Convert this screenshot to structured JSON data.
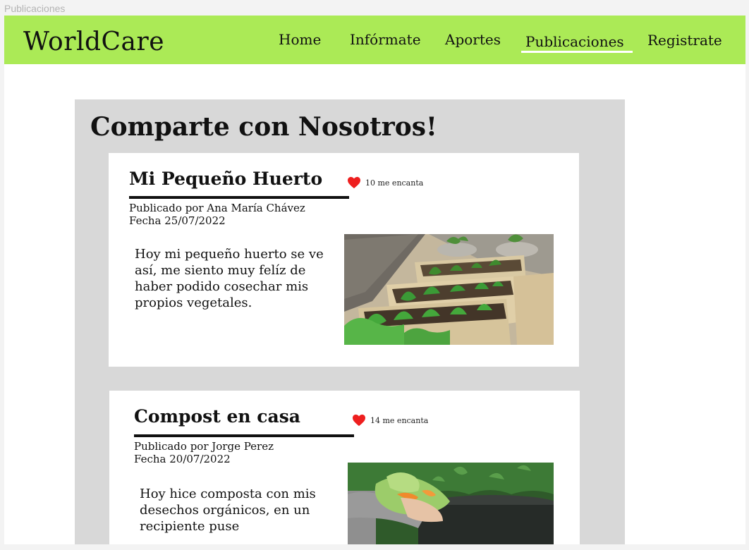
{
  "window": {
    "title": "Publicaciones"
  },
  "navbar": {
    "brand": "WorldCare",
    "items": [
      {
        "label": "Home"
      },
      {
        "label": "Infórmate"
      },
      {
        "label": "Aportes"
      },
      {
        "label": "Publicaciones",
        "active": true
      },
      {
        "label": "Registrate"
      }
    ]
  },
  "colors": {
    "navbar": "#abea56",
    "panel": "#d8d8d8",
    "heart": "#ee1f1f"
  },
  "main": {
    "title": "Comparte con Nosotros!",
    "posts": [
      {
        "title": "Mi Pequeño Huerto",
        "likes": "10 me encanta",
        "author": "Publicado por Ana María Chávez",
        "date": "Fecha 25/07/2022",
        "body": "Hoy mi pequeño huerto se ve así, me siento muy felíz de haber podido cosechar mis propios vegetales.",
        "image_icon": "garden-boxes-photo"
      },
      {
        "title": "Compost en casa",
        "likes": "14 me encanta",
        "author": "Publicado por Jorge Perez",
        "date": "Fecha 20/07/2022",
        "body": "Hoy hice composta con mis desechos orgánicos, en un recipiente puse",
        "image_icon": "compost-bin-photo"
      }
    ]
  }
}
